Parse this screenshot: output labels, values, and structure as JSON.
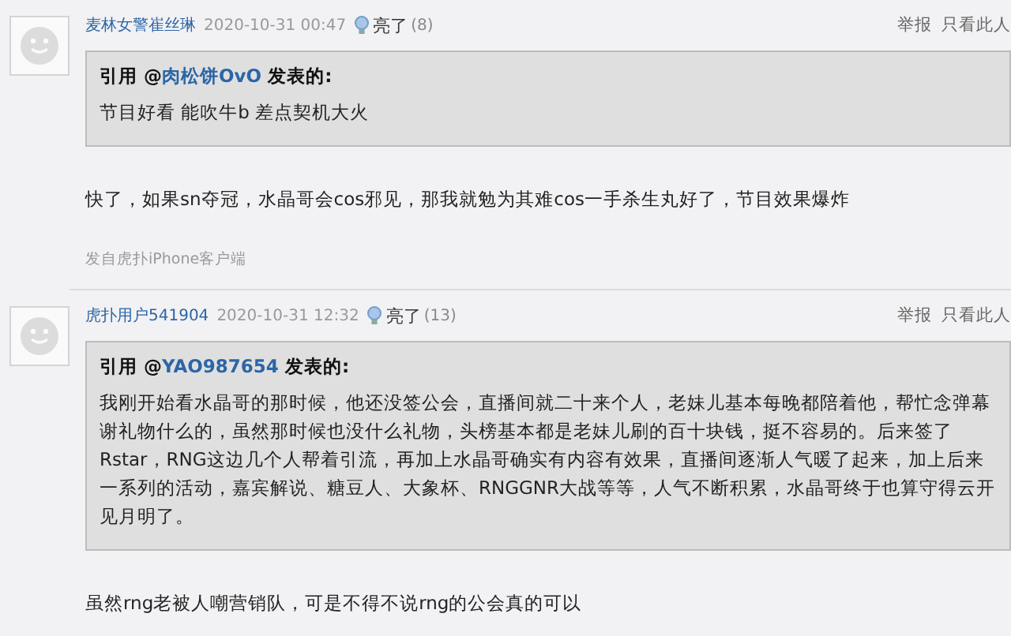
{
  "posts": [
    {
      "author": "麦林女警崔丝琳",
      "time": "2020-10-31 00:47",
      "light_label": "亮了",
      "light_count": "(8)",
      "actions": [
        "举报",
        "只看此人"
      ],
      "quote": {
        "prefix": "引用 @",
        "user": "肉松饼OvO",
        "suffix": " 发表的:",
        "paragraphs": [
          "节目好看 能吹牛b 差点契机大火"
        ]
      },
      "body": "快了，如果sn夺冠，水晶哥会cos邪见，那我就勉为其难cos一手杀生丸好了，节目效果爆炸",
      "source": "发自虎扑iPhone客户端"
    },
    {
      "author": "虎扑用户541904",
      "time": "2020-10-31 12:32",
      "light_label": "亮了",
      "light_count": "(13)",
      "actions": [
        "举报",
        "只看此人"
      ],
      "quote": {
        "prefix": "引用 @",
        "user": "YAO987654",
        "suffix": " 发表的:",
        "paragraphs": [
          "我刚开始看水晶哥的那时候，他还没签公会，直播间就二十来个人，老妹儿基本每晚都陪着他，帮忙念弹幕谢礼物什么的，虽然那时候也没什么礼物，头榜基本都是老妹儿刷的百十块钱，挺不容易的。后来签了Rstar，RNG这边几个人帮着引流，再加上水晶哥确实有内容有效果，直播间逐渐人气暖了起来，加上后来一系列的活动，嘉宾解说、糖豆人、大象杯、RNGGNR大战等等，人气不断积累，水晶哥终于也算守得云开见月明了。"
        ]
      },
      "body": "虽然rng老被人嘲营销队，可是不得不说rng的公会真的可以"
    }
  ]
}
